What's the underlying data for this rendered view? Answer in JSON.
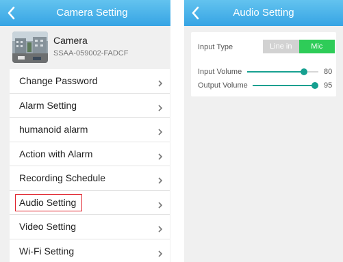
{
  "left_screen": {
    "header": {
      "title": "Camera Setting"
    },
    "camera": {
      "name": "Camera",
      "id": "SSAA-059002-FADCF"
    },
    "menu": [
      {
        "label": "Change Password"
      },
      {
        "label": "Alarm Setting"
      },
      {
        "label": "humanoid alarm"
      },
      {
        "label": "Action with Alarm"
      },
      {
        "label": "Recording Schedule"
      },
      {
        "label": "Audio Setting",
        "highlighted": true
      },
      {
        "label": "Video Setting"
      },
      {
        "label": "Wi-Fi Setting"
      }
    ]
  },
  "right_screen": {
    "header": {
      "title": "Audio Setting"
    },
    "input_type": {
      "label": "Input Type",
      "options": [
        "Line in",
        "Mic"
      ],
      "selected": "Mic"
    },
    "input_volume": {
      "label": "Input Volume",
      "value": "80",
      "level": 0.8
    },
    "output_volume": {
      "label": "Output Volume",
      "value": "95",
      "level": 0.95
    }
  },
  "colors": {
    "header": "#36a4e4",
    "accent": "#16a090",
    "toggle_on": "#2ecc58",
    "highlight": "#e0202a"
  },
  "icons": {
    "back": "chevron-left-icon",
    "chevron": "chevron-right-icon"
  }
}
